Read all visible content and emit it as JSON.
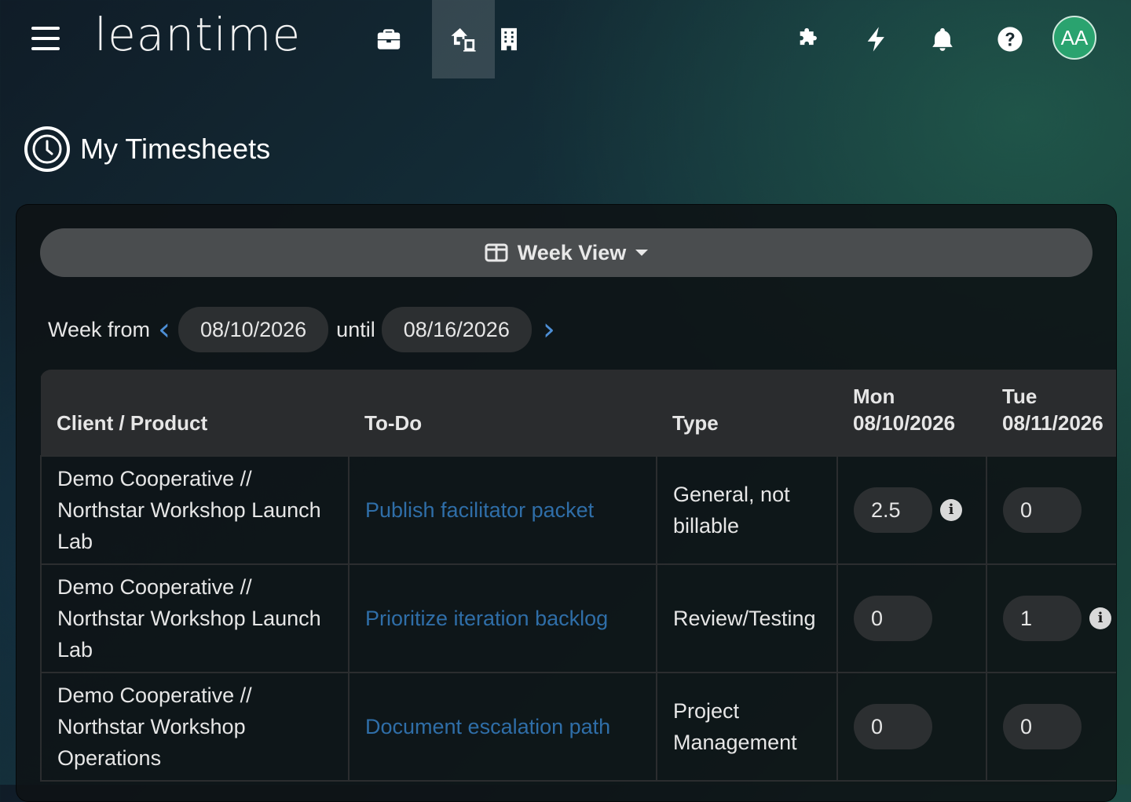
{
  "header": {
    "logo": "leantime",
    "avatar_initials": "AA",
    "icons": [
      "menu-icon",
      "briefcase-icon",
      "home-switch-icon",
      "building-icon",
      "puzzle-icon",
      "lightning-icon",
      "bell-icon",
      "help-icon"
    ]
  },
  "page": {
    "title": "My Timesheets"
  },
  "view": {
    "label": "Week View"
  },
  "range": {
    "from_label": "Week from",
    "from_date": "08/10/2026",
    "until_label": "until",
    "to_date": "08/16/2026"
  },
  "table": {
    "headers": {
      "client": "Client / Product",
      "todo": "To-Do",
      "type": "Type",
      "mon_day": "Mon",
      "mon_date": "08/10/2026",
      "tue_day": "Tue",
      "tue_date": "08/11/2026"
    },
    "rows": [
      {
        "client": "Demo Cooperative // Northstar Workshop Launch Lab",
        "todo": "Publish facilitator packet",
        "type": "General, not billable",
        "mon": "2.5",
        "tue": "0"
      },
      {
        "client": "Demo Cooperative // Northstar Workshop Launch Lab",
        "todo": "Prioritize iteration backlog",
        "type": "Review/Testing",
        "mon": "0",
        "tue": "1"
      },
      {
        "client": "Demo Cooperative // Northstar Workshop Operations",
        "todo": "Document escalation path",
        "type": "Project Management",
        "mon": "0",
        "tue": "0"
      }
    ]
  },
  "colors": {
    "accent": "#2aa36f",
    "link": "#2f6ea8",
    "chevron": "#4d8fd6"
  }
}
